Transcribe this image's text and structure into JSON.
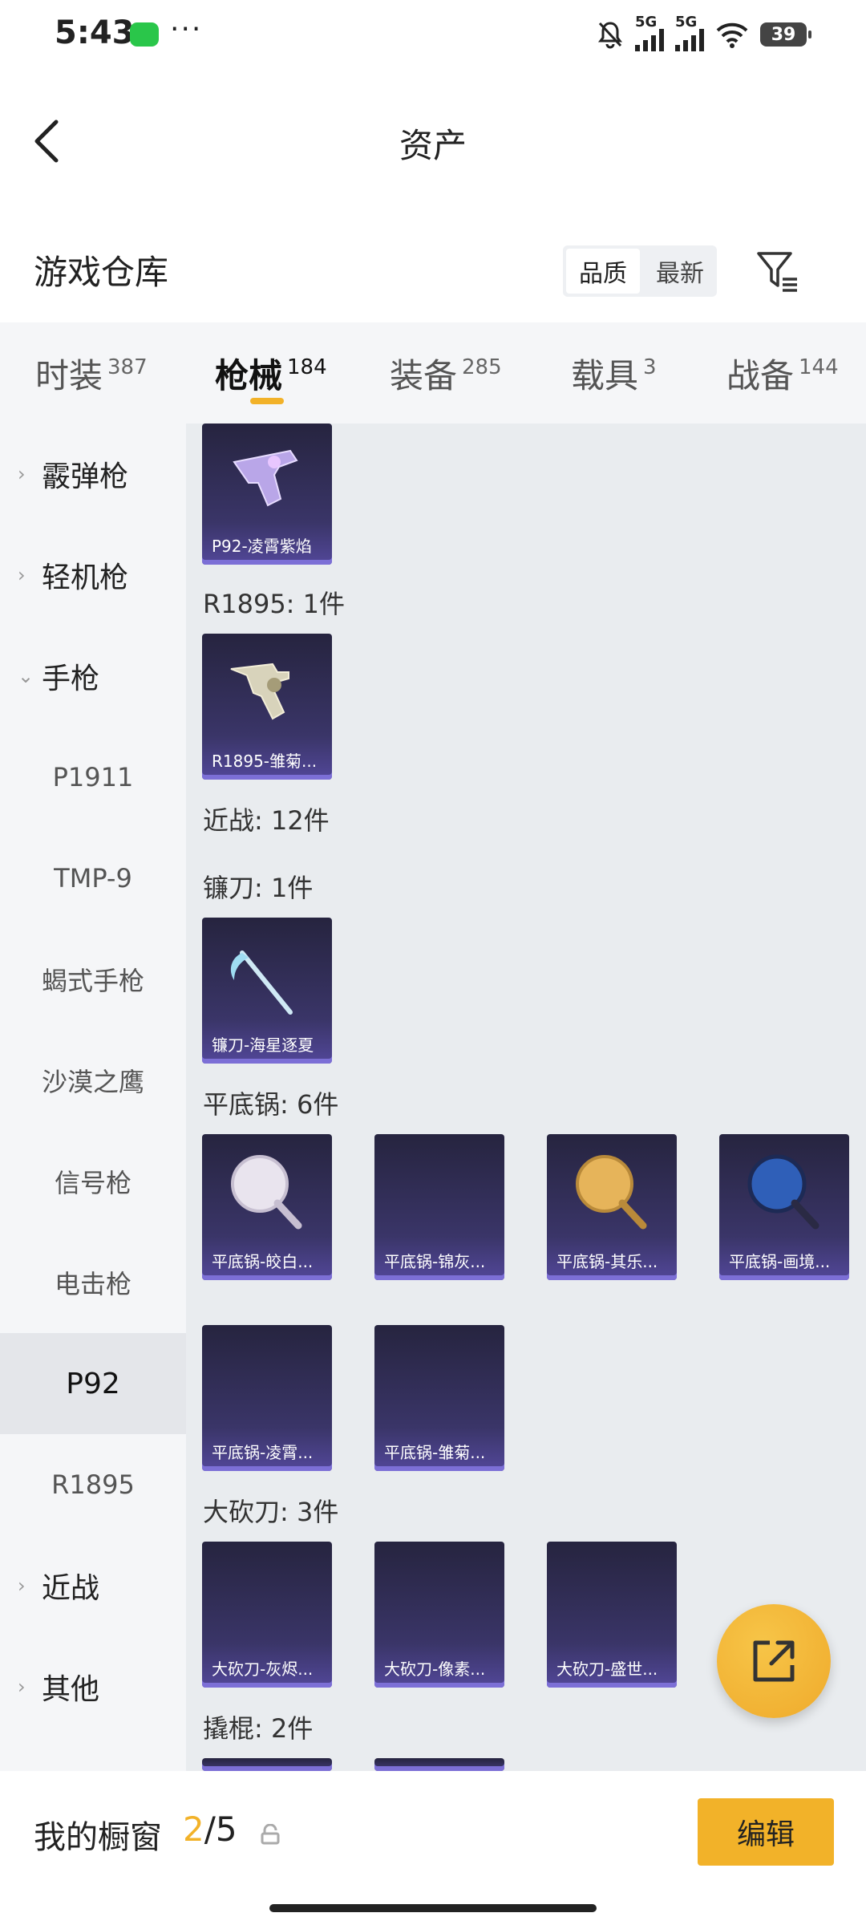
{
  "status_bar": {
    "time": "5:43",
    "battery": "39",
    "net1": "5G",
    "net2": "5G",
    "dots": "···"
  },
  "header": {
    "title": "资产"
  },
  "warehouse": {
    "title": "游戏仓库",
    "sort_options": [
      "品质",
      "最新"
    ],
    "active_sort": "品质"
  },
  "tabs": [
    {
      "label": "时装",
      "count": "387"
    },
    {
      "label": "枪械",
      "count": "184",
      "active": true
    },
    {
      "label": "装备",
      "count": "285"
    },
    {
      "label": "载具",
      "count": "3"
    },
    {
      "label": "战备",
      "count": "144"
    }
  ],
  "sidebar": [
    {
      "label": "霰弹枪",
      "type": "category",
      "expanded": false
    },
    {
      "label": "轻机枪",
      "type": "category",
      "expanded": false
    },
    {
      "label": "手枪",
      "type": "category",
      "expanded": true
    },
    {
      "label": "P1911",
      "type": "sub"
    },
    {
      "label": "TMP-9",
      "type": "sub"
    },
    {
      "label": "蝎式手枪",
      "type": "sub"
    },
    {
      "label": "沙漠之鹰",
      "type": "sub"
    },
    {
      "label": "信号枪",
      "type": "sub"
    },
    {
      "label": "电击枪",
      "type": "sub"
    },
    {
      "label": "P92",
      "type": "sub",
      "selected": true
    },
    {
      "label": "R1895",
      "type": "sub"
    },
    {
      "label": "近战",
      "type": "category",
      "expanded": false
    },
    {
      "label": "其他",
      "type": "category",
      "expanded": false
    }
  ],
  "content": {
    "groups": [
      {
        "label": "R1895: 1件"
      },
      {
        "label": "近战: 12件"
      },
      {
        "label": "镰刀: 1件"
      },
      {
        "label": "平底锅: 6件"
      },
      {
        "label": "大砍刀: 3件"
      },
      {
        "label": "撬棍: 2件"
      }
    ],
    "items": [
      "P92-凌霄紫焰",
      "R1895-雏菊...",
      "镰刀-海星逐夏",
      "平底锅-皎白...",
      "平底锅-锦灰...",
      "平底锅-其乐...",
      "平底锅-画境...",
      "平底锅-凌霄...",
      "平底锅-雏菊...",
      "大砍刀-灰烬...",
      "大砍刀-像素...",
      "大砍刀-盛世..."
    ]
  },
  "bottom_bar": {
    "label": "我的橱窗",
    "current": "2",
    "sep_total": "/5",
    "edit_label": "编辑"
  },
  "colors": {
    "accent": "#f2b229",
    "card_bg": "#2e2a52",
    "sidebar_bg": "#f5f6f8",
    "content_bg": "#e9ecef"
  }
}
